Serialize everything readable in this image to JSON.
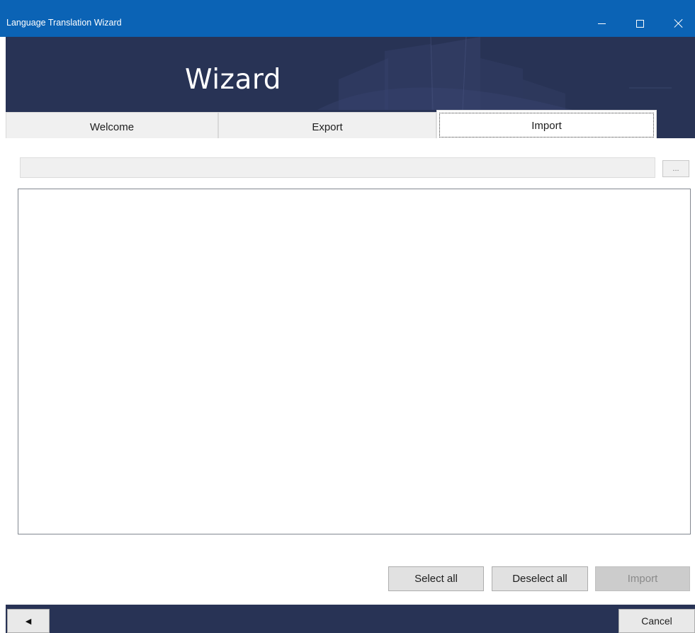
{
  "window": {
    "title": "Language Translation Wizard",
    "controls": {
      "minimize": "minimize-icon",
      "maximize": "maximize-icon",
      "close": "close-icon"
    }
  },
  "banner": {
    "title": "Wizard"
  },
  "tabs": [
    {
      "label": "Welcome",
      "selected": false
    },
    {
      "label": "Export",
      "selected": false
    },
    {
      "label": "Import",
      "selected": true
    }
  ],
  "import_panel": {
    "file_path": {
      "value": "",
      "placeholder": ""
    },
    "browse_label": "...",
    "items": [],
    "select_all_label": "Select all",
    "deselect_all_label": "Deselect all",
    "import_label": "Import",
    "import_enabled": false
  },
  "footer": {
    "back_icon": "back-arrow-icon",
    "back_glyph": "◄",
    "cancel_label": "Cancel"
  },
  "colors": {
    "titlebar": "#0b63b5",
    "banner": "#283355",
    "footer": "#283355",
    "tab_inactive": "#f0f0f0",
    "tab_active": "#ffffff"
  }
}
